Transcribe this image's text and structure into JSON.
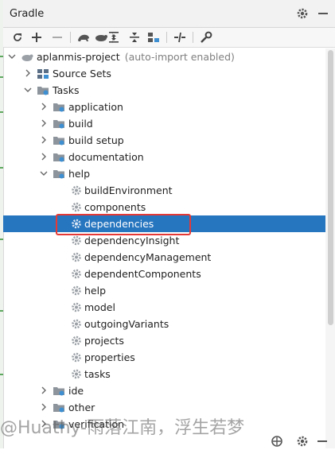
{
  "window": {
    "title": "Gradle"
  },
  "header_icons": [
    "gear-icon",
    "minimize-icon"
  ],
  "toolbar": {
    "icons": [
      "refresh-icon",
      "add-icon",
      "remove-icon",
      "execute-task-icon",
      "toggle-offline-icon",
      "expand-all-icon",
      "collapse-all-icon",
      "group-modules-icon",
      "toggle-dependencies-icon",
      "settings-wrench-icon"
    ]
  },
  "tree": {
    "root": {
      "label": "aplanmis-project",
      "suffix": "(auto-import enabled)"
    },
    "source_sets": "Source Sets",
    "tasks": "Tasks",
    "task_groups": [
      "application",
      "build",
      "build setup",
      "documentation"
    ],
    "help_group": "help",
    "help_tasks": [
      "buildEnvironment",
      "components",
      "dependencies",
      "dependencyInsight",
      "dependencyManagement",
      "dependentComponents",
      "help",
      "model",
      "outgoingVariants",
      "projects",
      "properties",
      "tasks"
    ],
    "after_groups": [
      "ide",
      "other",
      "verification"
    ],
    "selected": "dependencies"
  },
  "watermark": "@Huathy-雨落江南，浮生若梦",
  "colors": {
    "selection": "#2675bf",
    "highlight_box": "#e53935",
    "folder_gear": "#3d8fd1",
    "gear": "#9aa0a6"
  }
}
